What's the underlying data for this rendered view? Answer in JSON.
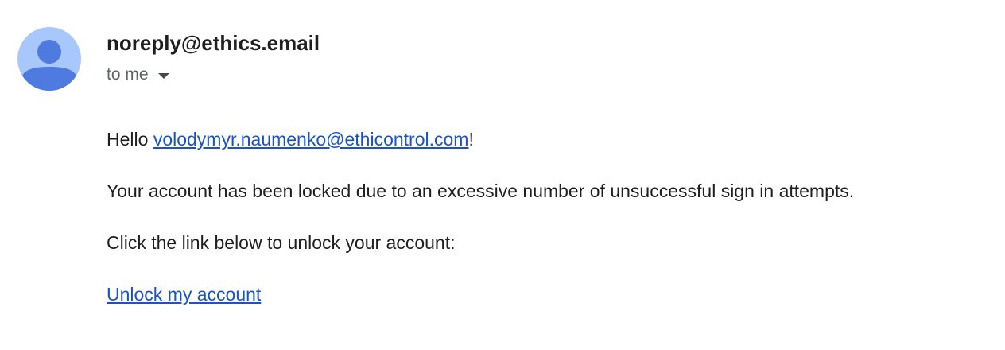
{
  "sender": {
    "avatar_icon": "person-avatar-icon",
    "name": "noreply@ethics.email"
  },
  "recipients": {
    "label": "to me",
    "toggle_icon": "caret-down-icon"
  },
  "message": {
    "greeting_prefix": "Hello ",
    "recipient_email": "volodymyr.naumenko@ethicontrol.com",
    "greeting_suffix": "!",
    "locked_text": "Your account has been locked due to an excessive number of unsuccessful sign in attempts.",
    "instructions": "Click the link below to unlock your account:",
    "unlock_link": "Unlock my account"
  },
  "colors": {
    "avatar_bg": "#a8c7fa",
    "avatar_figure": "#4f7be0",
    "link": "#1a53c4",
    "text": "#1f1f1f",
    "muted_text": "#5f6368"
  }
}
